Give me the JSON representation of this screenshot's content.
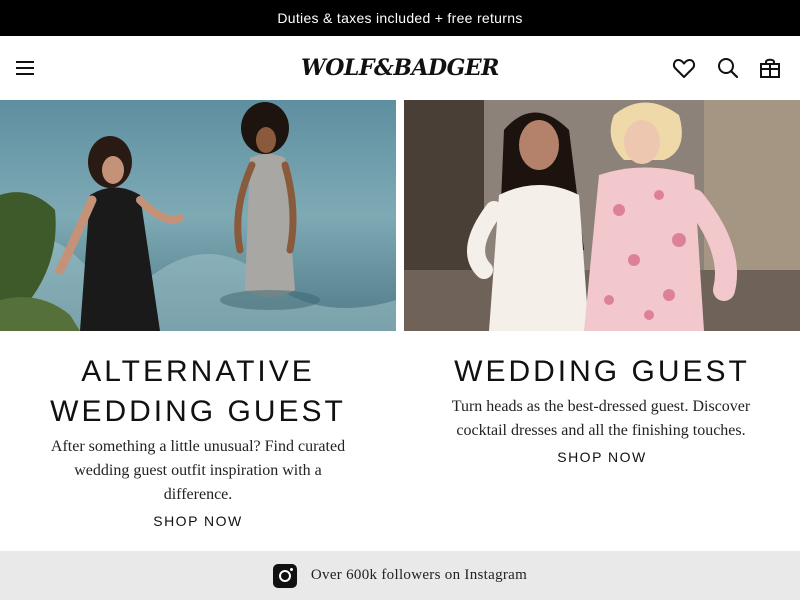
{
  "promo": {
    "text": "Duties & taxes included + free returns"
  },
  "header": {
    "logo": "WOLF&BADGER",
    "icons": [
      "menu-icon",
      "heart-icon",
      "search-icon",
      "bag-icon"
    ]
  },
  "cards": [
    {
      "title": "ALTERNATIVE WEDDING GUEST",
      "description": "After something a little unusual? Find curated wedding guest outfit inspiration with a difference.",
      "cta": "SHOP NOW"
    },
    {
      "title": "WEDDING GUEST",
      "description": "Turn heads as the best-dressed guest. Discover cocktail dresses and all the finishing touches.",
      "cta": "SHOP NOW"
    }
  ],
  "instagram": {
    "text": "Over 600k followers on Instagram",
    "icon": "instagram-icon"
  },
  "colors": {
    "promo_bg": "#000000",
    "footer_bar": "#e9e9e9",
    "text": "#111111"
  }
}
